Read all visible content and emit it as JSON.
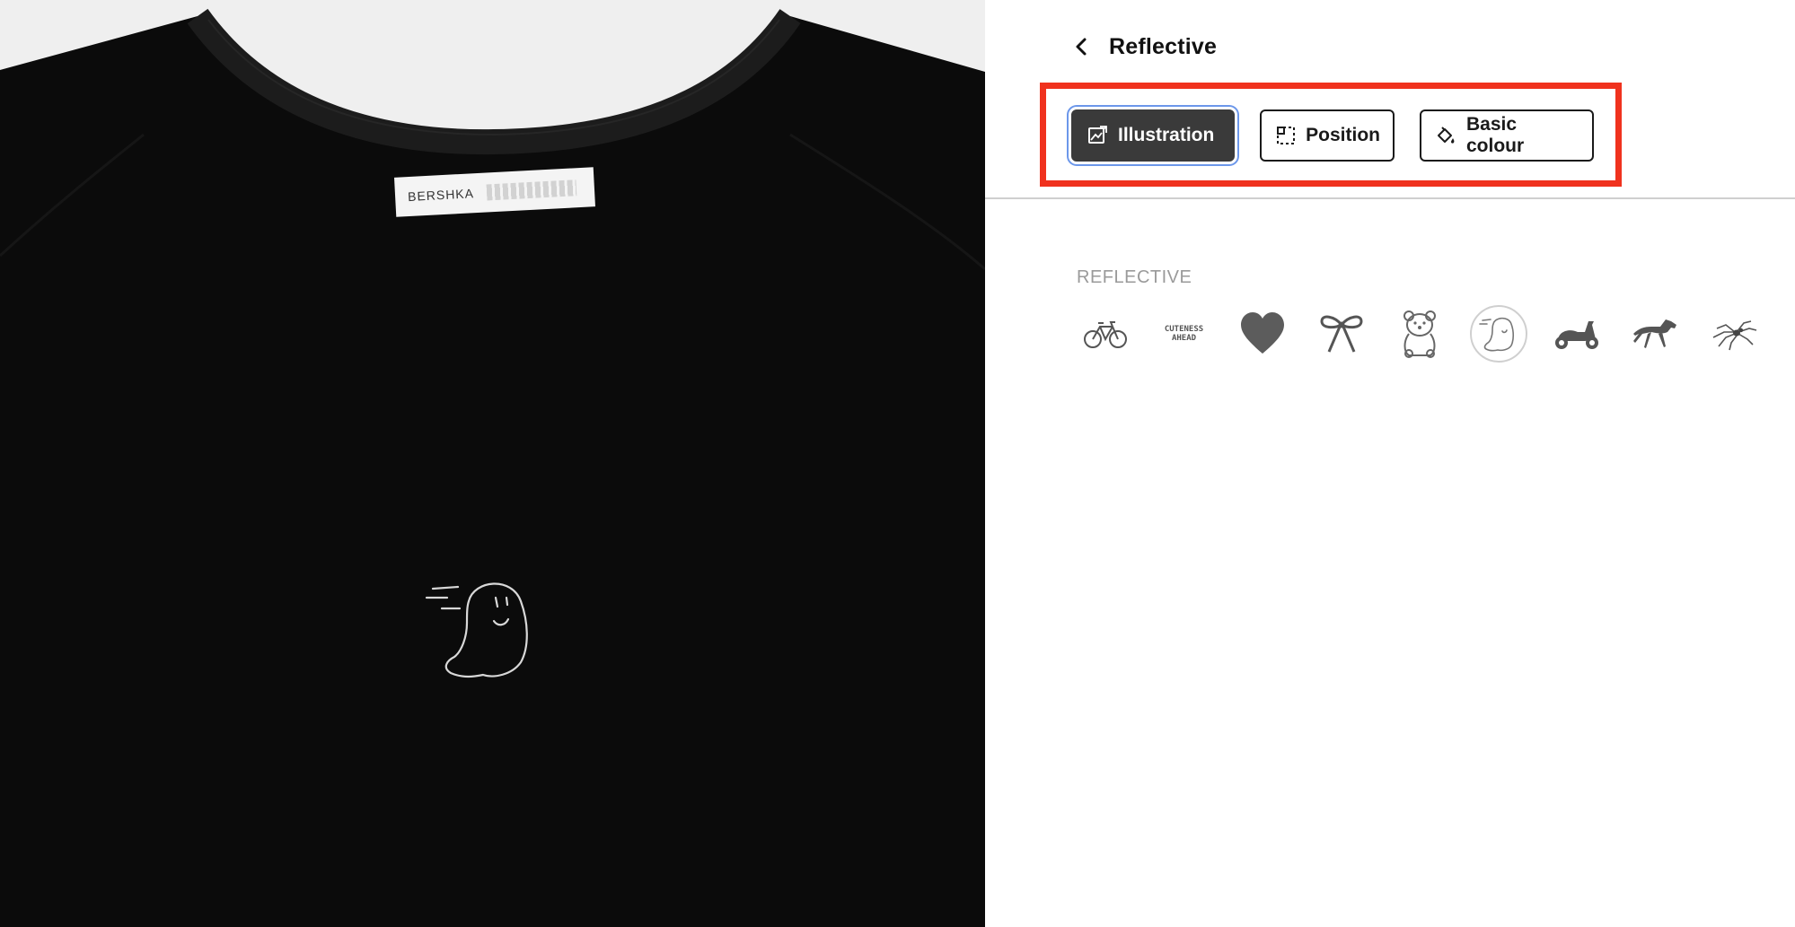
{
  "preview": {
    "label_brand": "BERSHKA",
    "shirt_color": "#0b0b0b"
  },
  "panel": {
    "title": "Reflective",
    "back_icon": "chevron-left-icon"
  },
  "tabs": [
    {
      "label": "Illustration",
      "icon": "image-edit-icon",
      "active": true
    },
    {
      "label": "Position",
      "icon": "position-icon",
      "active": false
    },
    {
      "label": "Basic colour",
      "icon": "paint-bucket-icon",
      "active": false
    }
  ],
  "section": {
    "label": "REFLECTIVE"
  },
  "illustrations": [
    {
      "icon": "bicycle-icon"
    },
    {
      "icon": "cuteness-ahead-text-icon",
      "text": "CUTENESS AHEAD"
    },
    {
      "icon": "heart-icon"
    },
    {
      "icon": "bow-icon"
    },
    {
      "icon": "teddy-bear-icon"
    },
    {
      "icon": "ghost-icon",
      "selected": true
    },
    {
      "icon": "scooter-icon"
    },
    {
      "icon": "horse-icon"
    },
    {
      "icon": "spider-icon"
    }
  ],
  "colors": {
    "highlight": "#f0321e",
    "active_tab": "#3a3a3a",
    "focus_ring": "#6c97ea",
    "section_label": "#9a9a9a"
  }
}
